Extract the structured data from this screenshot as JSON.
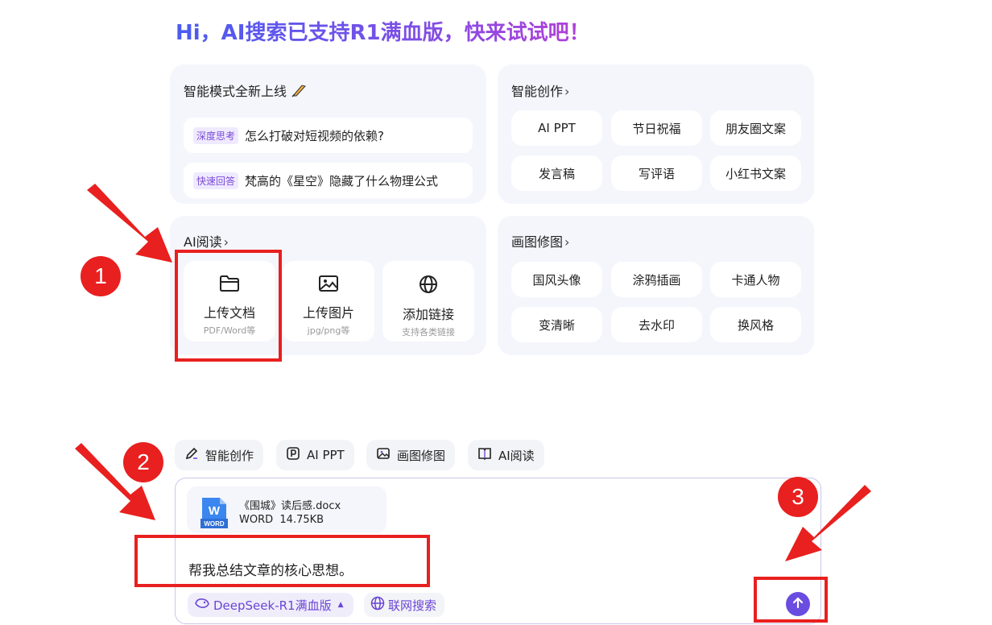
{
  "headline": "Hi，AI搜索已支持R1满血版，快来试试吧！",
  "smart_mode": {
    "title": "智能模式全新上线",
    "items": [
      {
        "tag": "深度思考",
        "text": "怎么打破对短视频的依赖?"
      },
      {
        "tag": "快速回答",
        "text": "梵高的《星空》隐藏了什么物理公式"
      }
    ]
  },
  "smart_create": {
    "title": "智能创作",
    "chevron": "›",
    "items": [
      "AI PPT",
      "节日祝福",
      "朋友圈文案",
      "发言稿",
      "写评语",
      "小红书文案"
    ]
  },
  "ai_read": {
    "title": "AI阅读",
    "chevron": "›",
    "tiles": [
      {
        "label": "上传文档",
        "sub": "PDF/Word等",
        "icon": "folder-icon"
      },
      {
        "label": "上传图片",
        "sub": "jpg/png等",
        "icon": "image-icon"
      },
      {
        "label": "添加链接",
        "sub": "支持各类链接",
        "icon": "globe-icon"
      }
    ]
  },
  "paint": {
    "title": "画图修图",
    "chevron": "›",
    "items": [
      "国风头像",
      "涂鸦插画",
      "卡通人物",
      "变清晰",
      "去水印",
      "换风格"
    ]
  },
  "chips": [
    {
      "label": "智能创作",
      "icon": "pen-icon"
    },
    {
      "label": "AI PPT",
      "icon": "ppt-icon"
    },
    {
      "label": "画图修图",
      "icon": "image-edit-icon"
    },
    {
      "label": "AI阅读",
      "icon": "book-icon"
    }
  ],
  "composer": {
    "file_name": "《围城》读后感.docx",
    "file_type": "WORD",
    "file_size": "14.75KB",
    "file_icon_text": "W",
    "file_icon_label": "WORD",
    "message": "帮我总结文章的核心思想。",
    "model_label": "DeepSeek-R1满血版",
    "web_search_label": "联网搜索"
  },
  "annotations": {
    "badges": [
      "1",
      "2",
      "3"
    ]
  },
  "colors": {
    "accent": "#6a4de0",
    "annotation_red": "#e8201f",
    "card_bg": "#f5f6fc"
  }
}
